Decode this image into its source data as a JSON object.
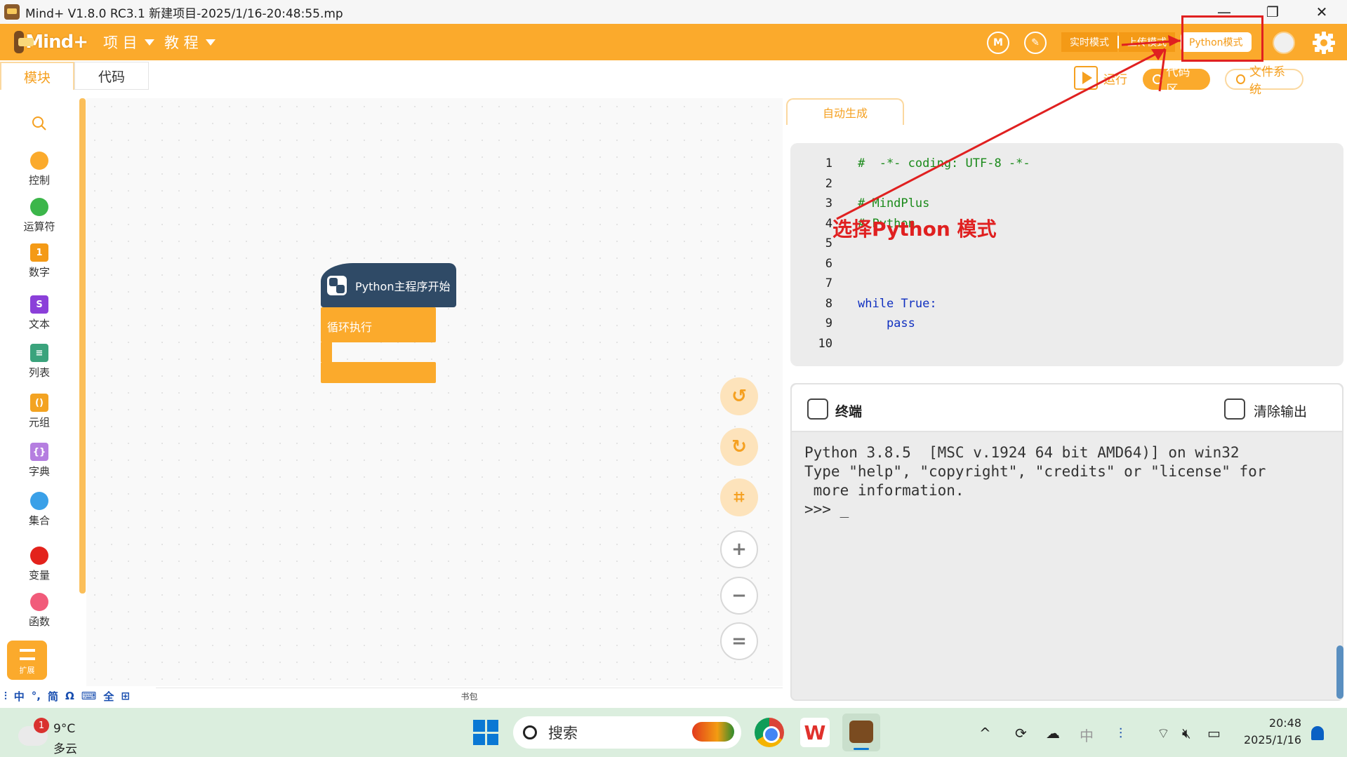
{
  "window": {
    "title": "Mind+ V1.8.0 RC3.1    新建项目-2025/1/16-20:48:55.mp",
    "minimize": "—",
    "maximize": "❐",
    "close": "✕"
  },
  "menubar": {
    "brand": "Mind+",
    "menus": [
      "项 目",
      "教 程"
    ],
    "modes": [
      "实时模式",
      "上传模式",
      "Python模式"
    ],
    "active_mode": "Python模式"
  },
  "tabs": {
    "blocks": "模块",
    "code": "代码"
  },
  "toolbar": {
    "run": "运行",
    "code_area": "代码区",
    "file_system": "文件系统"
  },
  "palette": {
    "categories": [
      {
        "label": "控制",
        "color": "#fbaa2c"
      },
      {
        "label": "运算符",
        "color": "#3cb64a"
      },
      {
        "label": "数字",
        "color": "#f49a16"
      },
      {
        "label": "文本",
        "color": "#8b3fd9"
      },
      {
        "label": "列表",
        "color": "#3aa37c"
      },
      {
        "label": "元组",
        "color": "#f3a322"
      },
      {
        "label": "字典",
        "color": "#b57ee0"
      },
      {
        "label": "集合",
        "color": "#3aa0e8"
      },
      {
        "label": "变量",
        "color": "#e3221c"
      },
      {
        "label": "函数",
        "color": "#f15b7a"
      }
    ],
    "number_glyph": "1",
    "extension": "扩展"
  },
  "workspace": {
    "hat_block": "Python主程序开始",
    "loop_block": "循环执行"
  },
  "code_panel": {
    "tab": "自动生成",
    "lines": [
      "#  -*- coding: UTF-8 -*-",
      "",
      "# MindPlus",
      "# Python",
      "",
      "",
      "",
      "while True:",
      "    pass",
      ""
    ]
  },
  "annotation": {
    "text": "选择Python 模式",
    "color": "#e02020"
  },
  "terminal": {
    "title": "终端",
    "clear": "清除输出",
    "output": [
      "Python 3.8.5  [MSC v.1924 64 bit AMD64)] on win32",
      "Type \"help\", \"copyright\", \"credits\" or \"license\" for",
      " more information.",
      ">>> _"
    ]
  },
  "statusbar": {
    "ime_items": [
      "中",
      "°,",
      "简",
      "Ω",
      "⌨",
      "全",
      "⊞"
    ],
    "bookbag": "书包"
  },
  "taskbar": {
    "weather_badge": "1",
    "temperature": "9°C",
    "condition": "多云",
    "search": "搜索",
    "tray": [
      "^",
      "中"
    ],
    "time": "20:48",
    "date": "2025/1/16"
  }
}
